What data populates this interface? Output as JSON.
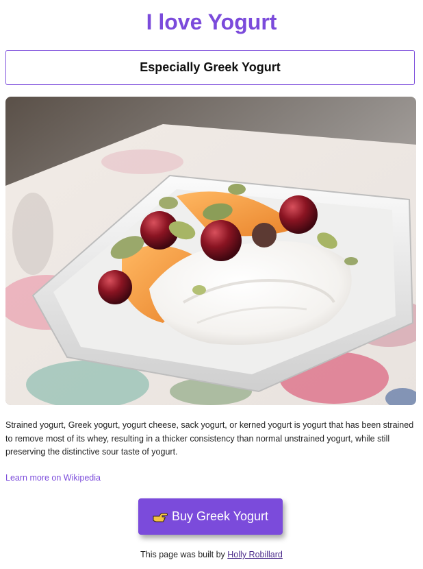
{
  "header": {
    "title": "I love Yogurt",
    "subtitle": "Especially Greek Yogurt"
  },
  "image": {
    "alt": "Greek yogurt in a white bowl with apricot slices, cherries and pistachios",
    "icon": "yogurt-photo"
  },
  "content": {
    "description": "Strained yogurt, Greek yogurt, yogurt cheese, sack yogurt, or kerned yogurt is yogurt that has been strained to remove most of its whey, resulting in a thicker consistency than normal unstrained yogurt, while still preserving the distinctive sour taste of yogurt.",
    "wiki_link": "Learn more on Wikipedia"
  },
  "cta": {
    "buy_label": "Buy Greek Yogurt",
    "icon": "pointing-hand-icon"
  },
  "footer": {
    "prefix": "This page was built by ",
    "author": "Holly Robillard"
  },
  "colors": {
    "accent": "#7b4bdb",
    "text": "#222222",
    "background": "#ffffff"
  }
}
